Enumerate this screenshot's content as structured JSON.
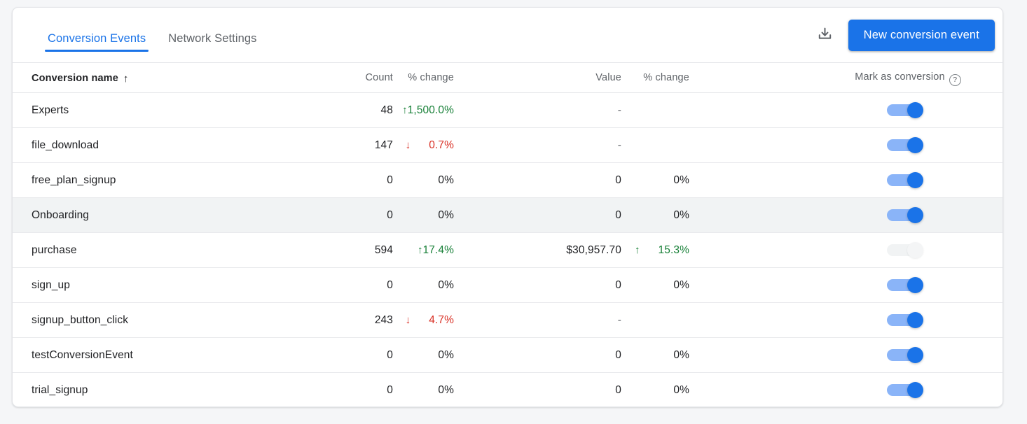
{
  "card": {
    "tabs": [
      {
        "label": "Conversion Events",
        "active": true
      },
      {
        "label": "Network Settings",
        "active": false
      }
    ],
    "actions": {
      "download_icon": "download-icon",
      "new_event_label": "New conversion event"
    }
  },
  "table": {
    "columns": {
      "name": "Conversion name",
      "sort_arrow": "↑",
      "count": "Count",
      "count_change": "% change",
      "value": "Value",
      "value_change": "% change",
      "mark": "Mark as conversion",
      "help_icon": "?"
    },
    "rows": [
      {
        "name": "Experts",
        "count": "48",
        "count_change": "1,500.0%",
        "count_dir": "up",
        "value": "-",
        "value_change": "",
        "value_dir": "none",
        "marked": true
      },
      {
        "name": "file_download",
        "count": "147",
        "count_change": "0.7%",
        "count_dir": "down",
        "value": "-",
        "value_change": "",
        "value_dir": "none",
        "marked": true
      },
      {
        "name": "free_plan_signup",
        "count": "0",
        "count_change": "0%",
        "count_dir": "flat",
        "value": "0",
        "value_change": "0%",
        "value_dir": "flat",
        "marked": true
      },
      {
        "name": "Onboarding",
        "count": "0",
        "count_change": "0%",
        "count_dir": "flat",
        "value": "0",
        "value_change": "0%",
        "value_dir": "flat",
        "marked": true,
        "highlighted": true
      },
      {
        "name": "purchase",
        "count": "594",
        "count_change": "17.4%",
        "count_dir": "up",
        "value": "$30,957.70",
        "value_change": "15.3%",
        "value_dir": "up",
        "marked": false
      },
      {
        "name": "sign_up",
        "count": "0",
        "count_change": "0%",
        "count_dir": "flat",
        "value": "0",
        "value_change": "0%",
        "value_dir": "flat",
        "marked": true
      },
      {
        "name": "signup_button_click",
        "count": "243",
        "count_change": "4.7%",
        "count_dir": "down",
        "value": "-",
        "value_change": "",
        "value_dir": "none",
        "marked": true
      },
      {
        "name": "testConversionEvent",
        "count": "0",
        "count_change": "0%",
        "count_dir": "flat",
        "value": "0",
        "value_change": "0%",
        "value_dir": "flat",
        "marked": true
      },
      {
        "name": "trial_signup",
        "count": "0",
        "count_change": "0%",
        "count_dir": "flat",
        "value": "0",
        "value_change": "0%",
        "value_dir": "flat",
        "marked": true
      }
    ]
  },
  "colors": {
    "accent": "#1a73e8",
    "positive": "#188038",
    "negative": "#d93025",
    "row_highlight": "#f1f3f4",
    "page_background": "#f5f6f8"
  }
}
